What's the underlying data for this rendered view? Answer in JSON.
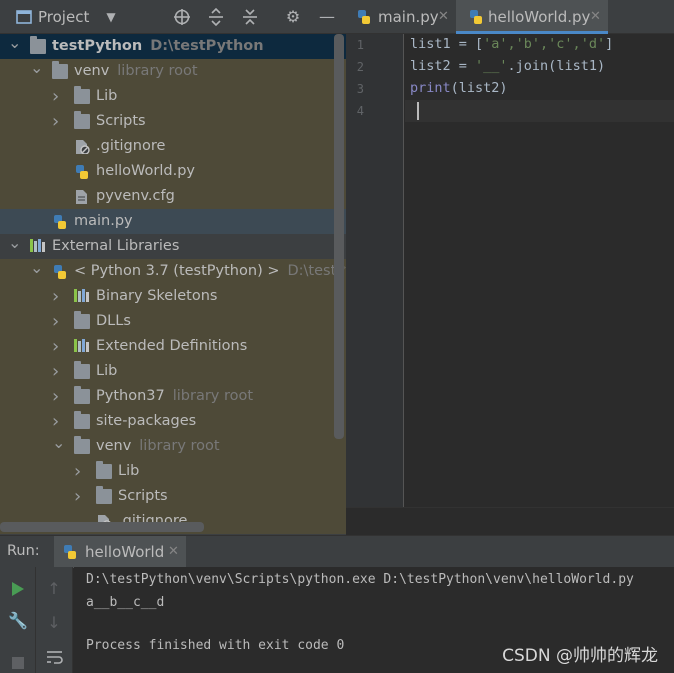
{
  "project_panel": {
    "title": "Project",
    "tree": [
      {
        "label": "testPython",
        "hint": "D:\\testPython",
        "icon": "folder-icon",
        "expanded": true
      },
      {
        "label": "venv",
        "hint": "library root",
        "icon": "folder-icon",
        "expanded": true
      },
      {
        "label": "Lib",
        "icon": "folder-icon"
      },
      {
        "label": "Scripts",
        "icon": "folder-icon"
      },
      {
        "label": ".gitignore",
        "icon": "ignored-file-icon"
      },
      {
        "label": "helloWorld.py",
        "icon": "python-file-icon"
      },
      {
        "label": "pyvenv.cfg",
        "icon": "config-file-icon"
      },
      {
        "label": "main.py",
        "icon": "python-file-icon"
      },
      {
        "label": "External Libraries",
        "icon": "library-icon",
        "expanded": true
      },
      {
        "label": "< Python 3.7 (testPython) >",
        "hint": "D:\\testPyth",
        "icon": "python-sdk-icon",
        "expanded": true
      },
      {
        "label": "Binary Skeletons",
        "icon": "library-icon"
      },
      {
        "label": "DLLs",
        "icon": "folder-icon"
      },
      {
        "label": "Extended Definitions",
        "icon": "library-icon"
      },
      {
        "label": "Lib",
        "icon": "folder-icon"
      },
      {
        "label": "Python37",
        "hint": "library root",
        "icon": "folder-icon"
      },
      {
        "label": "site-packages",
        "icon": "folder-icon"
      },
      {
        "label": "venv",
        "hint": "library root",
        "icon": "folder-icon",
        "expanded": true
      },
      {
        "label": "Lib",
        "icon": "folder-icon"
      },
      {
        "label": "Scripts",
        "icon": "folder-icon"
      },
      {
        "label": ".gitignore",
        "icon": "ignored-file-icon"
      }
    ]
  },
  "editor": {
    "tabs": [
      {
        "label": "main.py",
        "active": false
      },
      {
        "label": "helloWorld.py",
        "active": true
      }
    ],
    "line_numbers": [
      "1",
      "2",
      "3",
      "4"
    ],
    "code": {
      "line1_a": "list1 = [",
      "line1_str": "'a','b','c','d'",
      "line1_b": "]",
      "line2_a": "list2 = ",
      "line2_str": "'__'",
      "line2_b": ".join(list1)",
      "line3_kw": "print",
      "line3_b": "(list2)"
    }
  },
  "run_panel": {
    "label": "Run:",
    "tab_label": "helloWorld",
    "console": [
      "D:\\testPython\\venv\\Scripts\\python.exe D:\\testPython\\venv\\helloWorld.py",
      "a__b__c__d",
      "",
      "Process finished with exit code 0"
    ]
  },
  "watermark": "CSDN @帅帅的辉龙",
  "colors": {
    "accent": "#4a88c7",
    "run_green": "#499c54",
    "string": "#6a8759",
    "builtin": "#8888c6"
  }
}
